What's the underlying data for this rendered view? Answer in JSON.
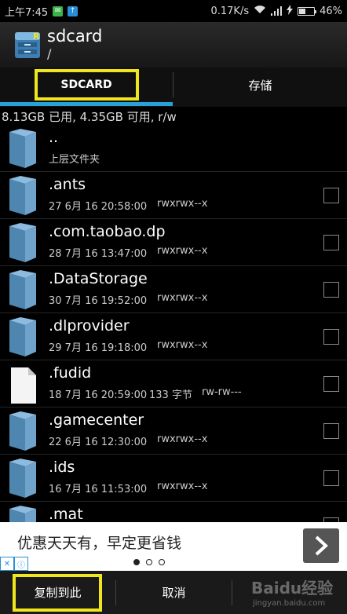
{
  "status_bar": {
    "time": "上午7:45",
    "notification_icons": [
      "green-app-icon",
      "upload-icon"
    ],
    "network_speed": "0.17K/s",
    "battery": "46%",
    "battery_level": 0.46
  },
  "header": {
    "title": "sdcard",
    "path": "/"
  },
  "tabs": [
    {
      "label": "SDCARD",
      "active": true
    },
    {
      "label": "存储",
      "active": false
    }
  ],
  "storage_info": "8.13GB 已用, 4.35GB 可用, r/w",
  "files": [
    {
      "name": "..",
      "sub": "上层文件夹",
      "type": "folder"
    },
    {
      "name": ".ants",
      "date": "27 6月 16 20:58:00",
      "perm": "rwxrwx--x",
      "type": "folder"
    },
    {
      "name": ".com.taobao.dp",
      "date": "28 7月 16 13:47:00",
      "perm": "rwxrwx--x",
      "type": "folder"
    },
    {
      "name": ".DataStorage",
      "date": "30 7月 16 19:52:00",
      "perm": "rwxrwx--x",
      "type": "folder"
    },
    {
      "name": ".dlprovider",
      "date": "29 7月 16 19:18:00",
      "perm": "rwxrwx--x",
      "type": "folder"
    },
    {
      "name": ".fudid",
      "date": "18 7月 16 20:59:00",
      "size": "133 字节",
      "perm": "rw-rw---",
      "type": "file"
    },
    {
      "name": ".gamecenter",
      "date": "22 6月 16 12:30:00",
      "perm": "rwxrwx--x",
      "type": "folder"
    },
    {
      "name": ".ids",
      "date": "16 7月 16 11:53:00",
      "perm": "rwxrwx--x",
      "type": "folder"
    },
    {
      "name": ".mat",
      "date": "",
      "perm": "",
      "type": "folder"
    }
  ],
  "ad": {
    "text": "优惠天天有，早定更省钱",
    "page_count": 3,
    "active_page": 1
  },
  "bottom_bar": {
    "paste_label": "复制到此",
    "cancel_label": "取消",
    "watermark": "Baidu经验",
    "watermark_sub": "jingyan.baidu.com"
  },
  "colors": {
    "accent": "#2aa0d8",
    "highlight_box": "#f0e61e",
    "folder": "#4f86b0"
  }
}
